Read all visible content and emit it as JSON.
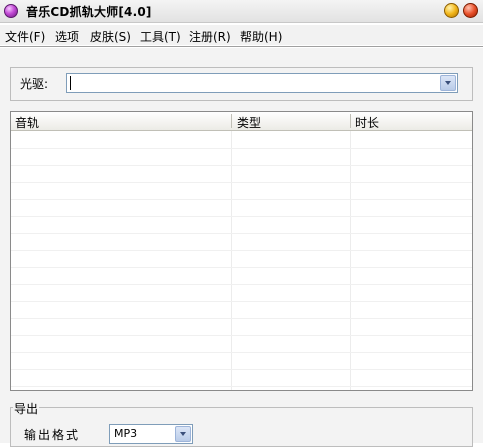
{
  "window": {
    "title": "音乐CD抓轨大师[4.0]"
  },
  "menu": {
    "items": [
      {
        "label": "文件(F)"
      },
      {
        "label": "选项"
      },
      {
        "label": "皮肤(S)"
      },
      {
        "label": "工具(T)"
      },
      {
        "label": "注册(R)"
      },
      {
        "label": "帮助(H)"
      }
    ]
  },
  "drive": {
    "label": "光驱:",
    "value": ""
  },
  "tracklist": {
    "columns": [
      "音轨",
      "类型",
      "时长"
    ],
    "rows": []
  },
  "export": {
    "group_title": "导出",
    "format_label": "输出格式",
    "format_value": "MP3"
  },
  "colors": {
    "accent": "#7f9db9",
    "app_icon": "#c34bd6",
    "minimize": "#f2b61a",
    "close": "#e8502a"
  },
  "icons": {
    "app": "purple-orb-icon",
    "minimize": "yellow-orb-icon",
    "close": "red-orb-icon",
    "dropdown": "chevron-down-icon"
  }
}
